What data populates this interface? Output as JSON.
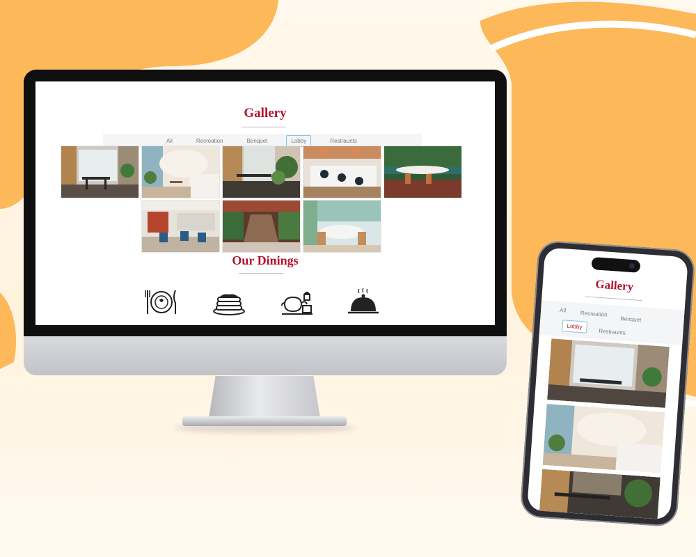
{
  "desktop": {
    "gallery_title": "Gallery",
    "tabs": [
      {
        "label": "All",
        "active": false
      },
      {
        "label": "Recreation",
        "active": false
      },
      {
        "label": "Benquet",
        "active": false
      },
      {
        "label": "Lobby",
        "active": true
      },
      {
        "label": "Restraunts",
        "active": false
      }
    ],
    "dinings_title": "Our Dinings",
    "dining_icons": [
      "plate-fork-knife-icon",
      "pancakes-icon",
      "teapot-cupcake-icon",
      "cloche-icon"
    ]
  },
  "mobile": {
    "gallery_title": "Gallery",
    "tabs": [
      {
        "label": "All",
        "active": false
      },
      {
        "label": "Recreation",
        "active": false
      },
      {
        "label": "Benquet",
        "active": false
      },
      {
        "label": "Lobby",
        "active": true
      },
      {
        "label": "Restraunts",
        "active": false
      }
    ]
  },
  "colors": {
    "accent": "#b3122e",
    "orange_blob": "#fdb85a",
    "active_tab_border": "#8fc0e0"
  }
}
